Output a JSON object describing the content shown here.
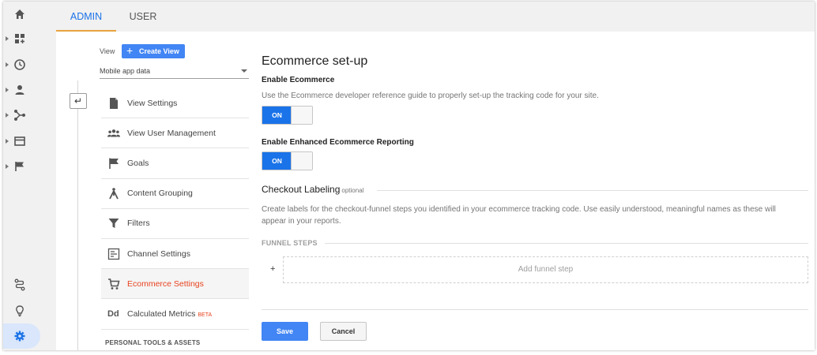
{
  "tabs": {
    "admin": "ADMIN",
    "user": "USER"
  },
  "rail": {
    "items": [
      "home-icon",
      "dashboard-icon",
      "clock-icon",
      "person-icon",
      "acquisition-icon",
      "behavior-icon",
      "flag-icon"
    ],
    "bottom": [
      "discover-icon",
      "lightbulb-icon",
      "gear-icon"
    ]
  },
  "view": {
    "label": "View",
    "create_button": "Create View",
    "selected": "Mobile app data"
  },
  "menu": {
    "items": [
      {
        "label": "View Settings",
        "icon": "document-icon"
      },
      {
        "label": "View User Management",
        "icon": "users-icon"
      },
      {
        "label": "Goals",
        "icon": "flag-icon"
      },
      {
        "label": "Content Grouping",
        "icon": "content-grouping-icon"
      },
      {
        "label": "Filters",
        "icon": "filter-icon"
      },
      {
        "label": "Channel Settings",
        "icon": "channel-icon"
      },
      {
        "label": "Ecommerce Settings",
        "icon": "cart-icon"
      },
      {
        "label": "Calculated Metrics",
        "icon": "dd-icon",
        "badge": "BETA"
      }
    ],
    "section": "PERSONAL TOOLS & ASSETS"
  },
  "main": {
    "title": "Ecommerce set-up",
    "enable_ecommerce": {
      "label": "Enable Ecommerce",
      "description": "Use the Ecommerce developer reference guide to properly set-up the tracking code for your site.",
      "toggle": "ON"
    },
    "enhanced": {
      "label": "Enable Enhanced Ecommerce Reporting",
      "toggle": "ON"
    },
    "checkout": {
      "title": "Checkout Labeling",
      "optional": "optional",
      "description_line1": "Create labels for the checkout-funnel steps you identified in your ecommerce tracking code. Use easily understood, meaningful names as these will",
      "description_line2": "appear in your reports."
    },
    "funnel": {
      "title": "FUNNEL STEPS",
      "plus": "+",
      "add_label": "Add funnel step"
    },
    "save": "Save",
    "cancel": "Cancel"
  },
  "colors": {
    "accent": "#4285f4",
    "active_text": "#e8431f",
    "tab_underline": "#e6a33e"
  }
}
